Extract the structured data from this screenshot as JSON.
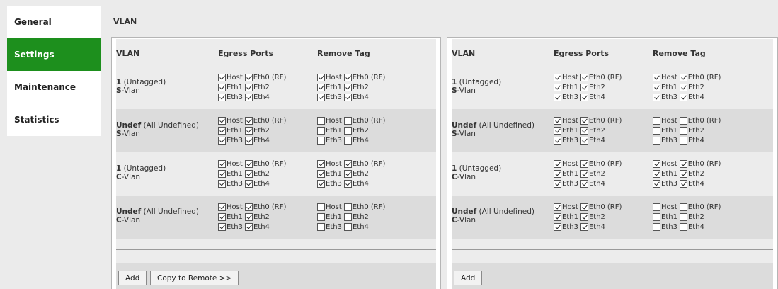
{
  "sidebar": {
    "items": [
      {
        "label": "General"
      },
      {
        "label": "Settings"
      },
      {
        "label": "Maintenance"
      },
      {
        "label": "Statistics"
      }
    ]
  },
  "section_title": "VLAN",
  "columns": {
    "vlan": "VLAN",
    "egress": "Egress Ports",
    "remove": "Remove Tag"
  },
  "port_rows": [
    [
      "Host",
      "Eth0 (RF)"
    ],
    [
      "Eth1",
      "Eth2"
    ],
    [
      "Eth3",
      "Eth4"
    ]
  ],
  "panels": [
    {
      "id": "left",
      "rows": [
        {
          "id": "1",
          "desc": " (Untagged)",
          "prefix": "S",
          "suffix": "-Vlan",
          "egress": [
            [
              true,
              true
            ],
            [
              true,
              true
            ],
            [
              true,
              true
            ]
          ],
          "remove": [
            [
              true,
              true
            ],
            [
              true,
              true
            ],
            [
              true,
              true
            ]
          ]
        },
        {
          "id": "Undef",
          "desc": " (All Undefined)",
          "prefix": "S",
          "suffix": "-Vlan",
          "egress": [
            [
              true,
              true
            ],
            [
              true,
              true
            ],
            [
              true,
              true
            ]
          ],
          "remove": [
            [
              false,
              false
            ],
            [
              false,
              false
            ],
            [
              false,
              false
            ]
          ]
        },
        {
          "id": "1",
          "desc": " (Untagged)",
          "prefix": "C",
          "suffix": "-Vlan",
          "egress": [
            [
              true,
              true
            ],
            [
              true,
              true
            ],
            [
              true,
              true
            ]
          ],
          "remove": [
            [
              true,
              true
            ],
            [
              true,
              true
            ],
            [
              true,
              true
            ]
          ]
        },
        {
          "id": "Undef",
          "desc": " (All Undefined)",
          "prefix": "C",
          "suffix": "-Vlan",
          "egress": [
            [
              true,
              true
            ],
            [
              true,
              true
            ],
            [
              true,
              true
            ]
          ],
          "remove": [
            [
              false,
              false
            ],
            [
              false,
              false
            ],
            [
              false,
              false
            ]
          ]
        }
      ],
      "buttons": [
        "Add",
        "Copy to Remote >>"
      ]
    },
    {
      "id": "right",
      "rows": [
        {
          "id": "1",
          "desc": " (Untagged)",
          "prefix": "S",
          "suffix": "-Vlan",
          "egress": [
            [
              true,
              true
            ],
            [
              true,
              true
            ],
            [
              true,
              true
            ]
          ],
          "remove": [
            [
              true,
              true
            ],
            [
              true,
              true
            ],
            [
              true,
              true
            ]
          ]
        },
        {
          "id": "Undef",
          "desc": " (All Undefined)",
          "prefix": "S",
          "suffix": "-Vlan",
          "egress": [
            [
              true,
              true
            ],
            [
              true,
              true
            ],
            [
              true,
              true
            ]
          ],
          "remove": [
            [
              false,
              false
            ],
            [
              false,
              false
            ],
            [
              false,
              false
            ]
          ]
        },
        {
          "id": "1",
          "desc": " (Untagged)",
          "prefix": "C",
          "suffix": "-Vlan",
          "egress": [
            [
              true,
              true
            ],
            [
              true,
              true
            ],
            [
              true,
              true
            ]
          ],
          "remove": [
            [
              true,
              true
            ],
            [
              true,
              true
            ],
            [
              true,
              true
            ]
          ]
        },
        {
          "id": "Undef",
          "desc": " (All Undefined)",
          "prefix": "C",
          "suffix": "-Vlan",
          "egress": [
            [
              true,
              true
            ],
            [
              true,
              true
            ],
            [
              true,
              true
            ]
          ],
          "remove": [
            [
              false,
              false
            ],
            [
              false,
              false
            ],
            [
              false,
              false
            ]
          ]
        }
      ],
      "buttons": [
        "Add"
      ]
    }
  ]
}
